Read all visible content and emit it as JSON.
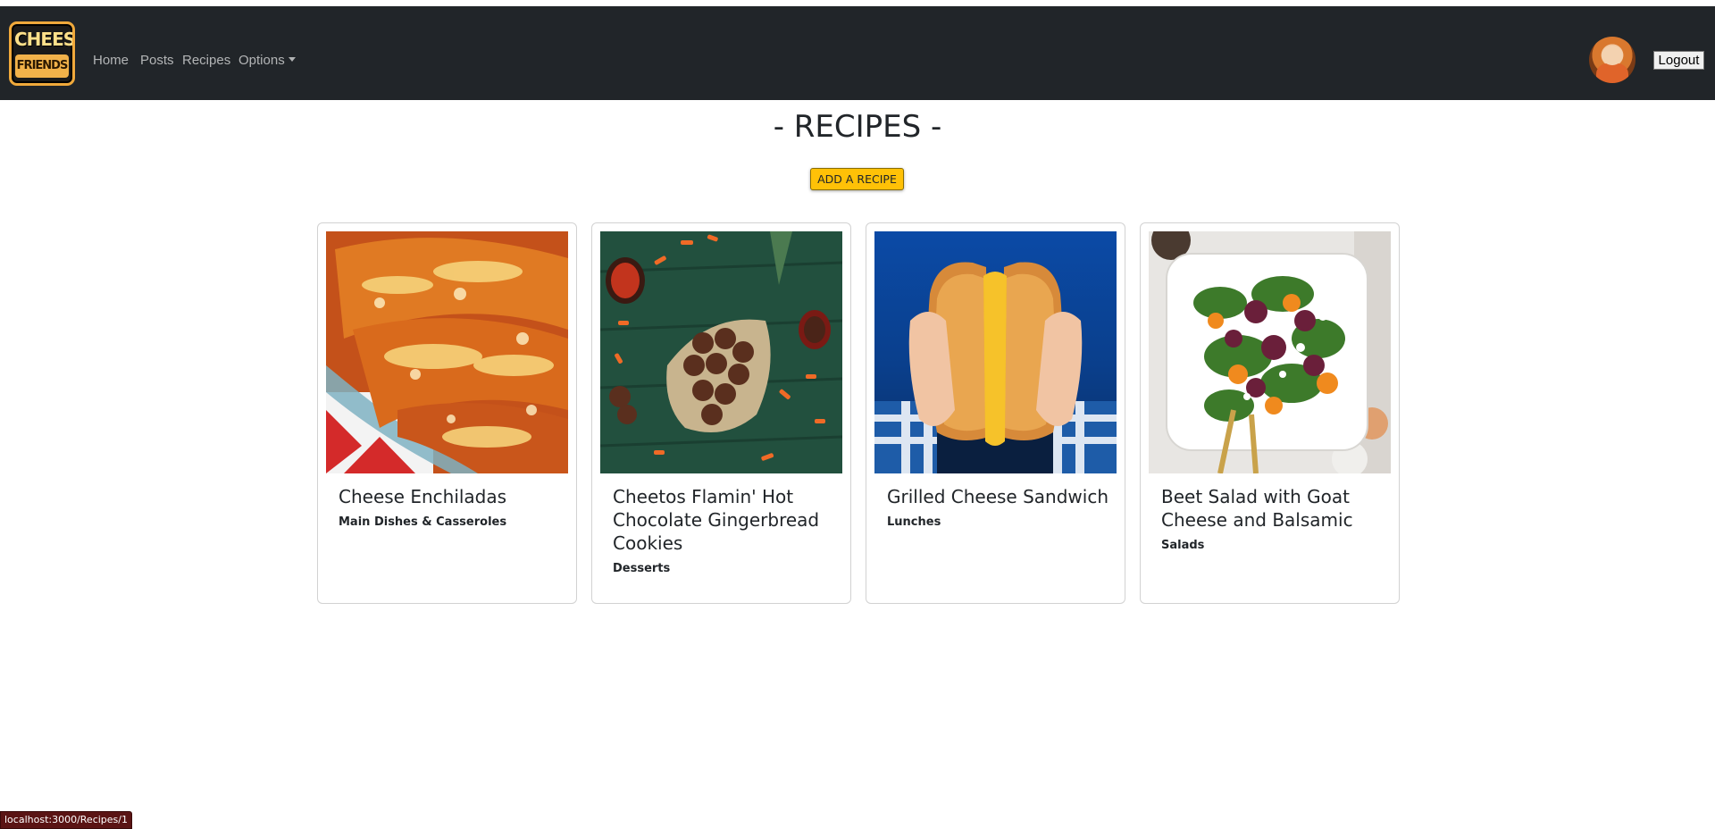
{
  "navbar": {
    "logo_text_top": "CHEESE",
    "logo_text_bottom": "FRIENDS",
    "links": [
      {
        "label": "Home"
      },
      {
        "label": "Posts"
      },
      {
        "label": "Recipes"
      },
      {
        "label": "Options"
      }
    ],
    "logout_label": "Logout",
    "colors": {
      "background": "#212529",
      "link": "rgba(255,255,255,0.65)"
    }
  },
  "main": {
    "title": "- RECIPES -",
    "add_button_label": "ADD A RECIPE",
    "add_button_color": "#ffc107"
  },
  "recipes": [
    {
      "title": "Cheese Enchiladas",
      "category": "Main Dishes & Casseroles",
      "image": "enchiladas-photo"
    },
    {
      "title": "Cheetos Flamin' Hot Chocolate Gingerbread Cookies",
      "category": "Desserts",
      "image": "cookies-photo"
    },
    {
      "title": "Grilled Cheese Sandwich",
      "category": "Lunches",
      "image": "grilled-cheese-photo"
    },
    {
      "title": "Beet Salad with Goat Cheese and Balsamic",
      "category": "Salads",
      "image": "beet-salad-photo"
    }
  ],
  "status_bar": {
    "url": "localhost:3000/Recipes/1"
  }
}
